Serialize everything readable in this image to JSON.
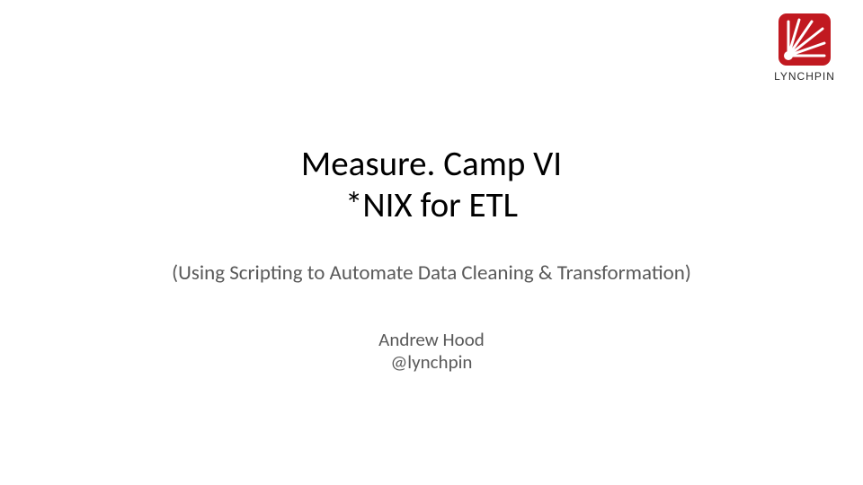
{
  "logo": {
    "name": "LYNCHPIN",
    "color": "#c11920"
  },
  "title": {
    "line1": "Measure. Camp VI",
    "line2": "*NIX for ETL"
  },
  "subtitle": "(Using Scripting to Automate Data Cleaning & Transformation)",
  "author": {
    "name": "Andrew Hood",
    "handle": "@lynchpin"
  }
}
